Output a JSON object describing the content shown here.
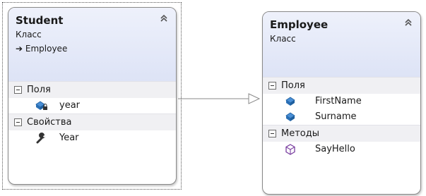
{
  "classes": {
    "student": {
      "name": "Student",
      "stereotype": "Класс",
      "inherits": "Employee",
      "sections": {
        "fields": {
          "label": "Поля",
          "items": [
            "year"
          ]
        },
        "properties": {
          "label": "Свойства",
          "items": [
            "Year"
          ]
        }
      }
    },
    "employee": {
      "name": "Employee",
      "stereotype": "Класс",
      "sections": {
        "fields": {
          "label": "Поля",
          "items": [
            "FirstName",
            "Surname"
          ]
        },
        "methods": {
          "label": "Методы",
          "items": [
            "SayHello"
          ]
        }
      }
    }
  },
  "icons": {
    "collapse": "double-chevron-up-icon",
    "field_private": "field-private-icon",
    "field": "field-icon",
    "property": "wrench-icon",
    "method": "method-cube-icon",
    "inherit_arrow": "arrow-right-icon"
  },
  "colors": {
    "header_top": "#eef1fb",
    "header_bottom": "#dde3f6",
    "field_icon": "#2a6fb5",
    "method_icon": "#7a3fa0"
  }
}
